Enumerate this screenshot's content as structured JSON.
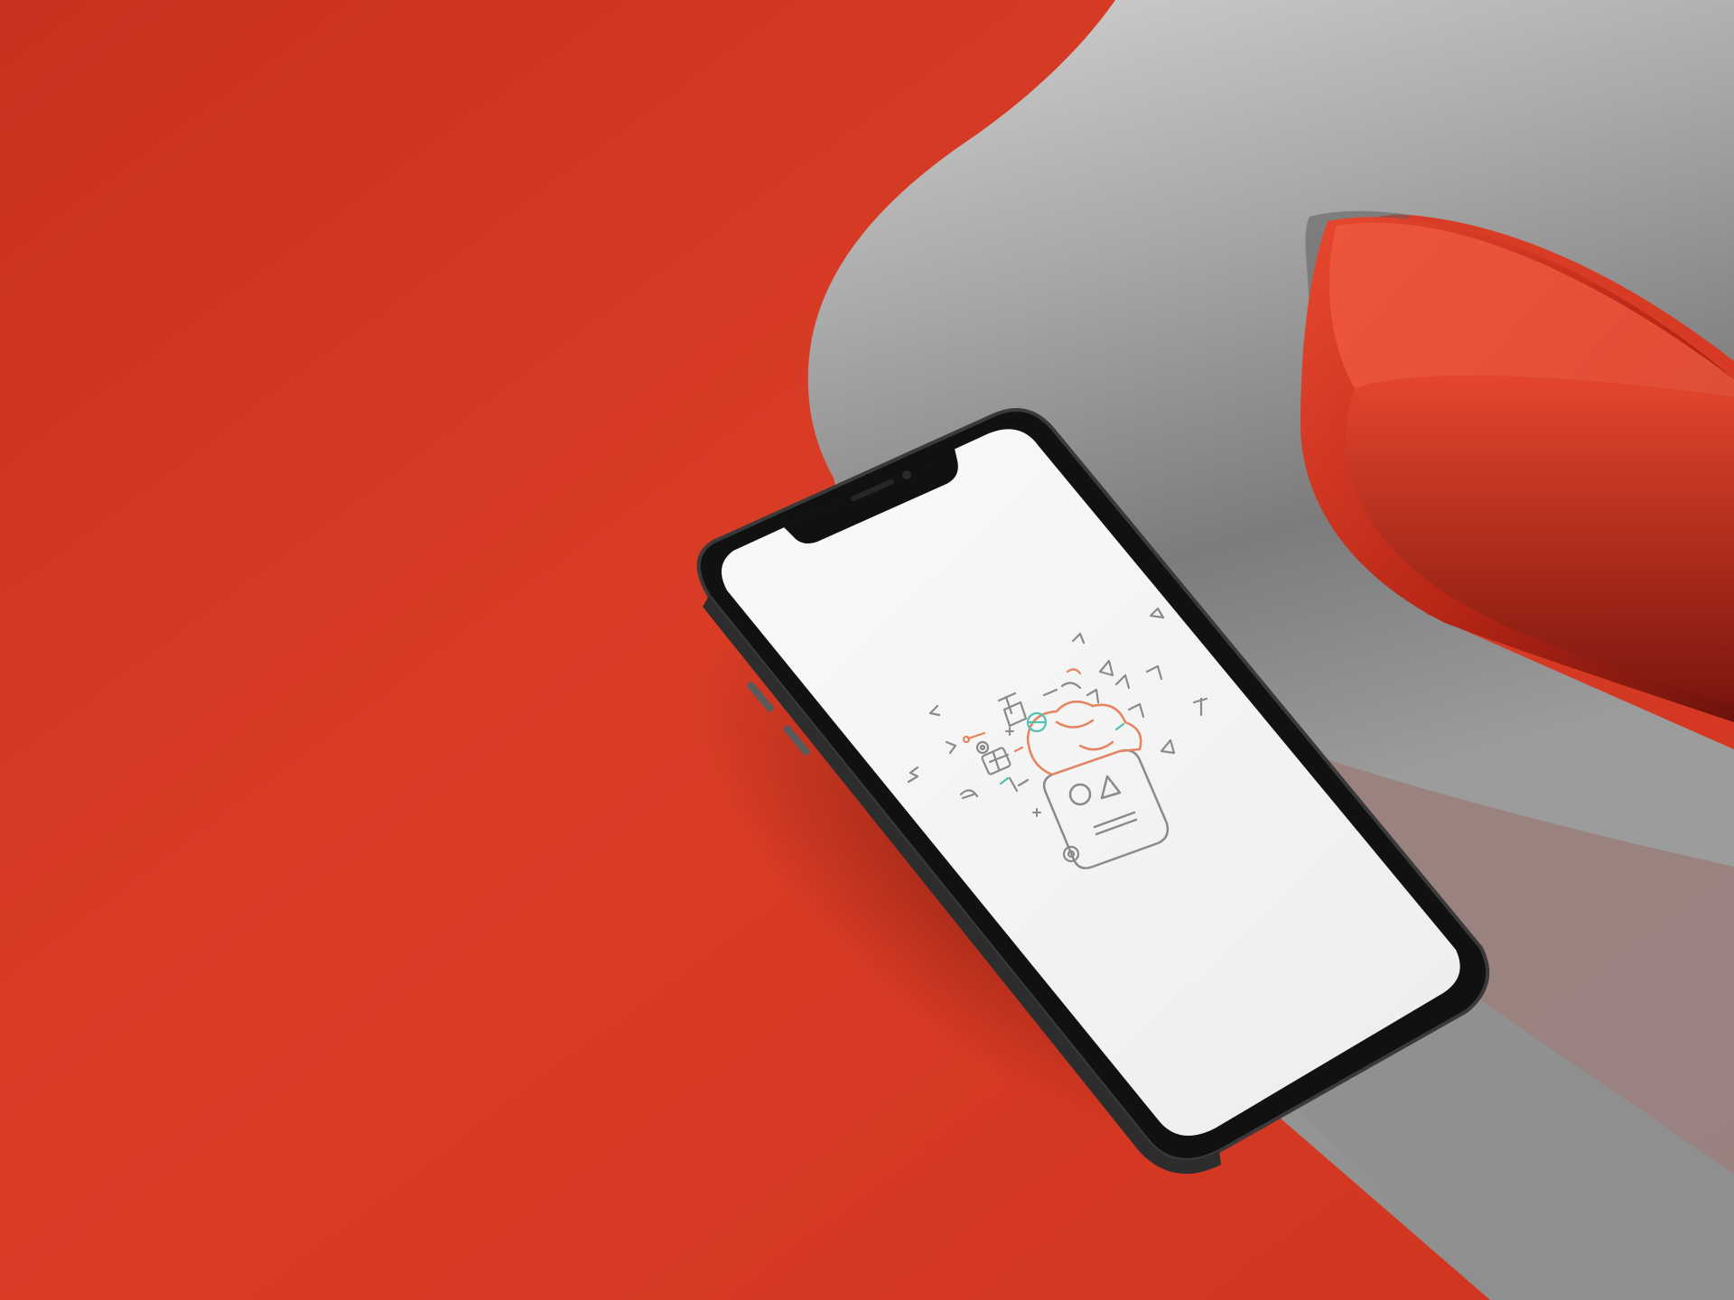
{
  "scene": {
    "background_color": "#d63a24",
    "background_shadow_color": "#9e2112",
    "ribbon_light_color": "#c9c9c9",
    "ribbon_mid_color": "#9a9a9a",
    "ribbon_dark_color": "#5b5b5b",
    "ribbon_red_color": "#e14530",
    "ribbon_red_dark_color": "#7a140d",
    "phone_frame_color": "#111111",
    "phone_rim_color": "#3a3a3a",
    "screen_color": "#f4f4f4"
  },
  "wallpaper": {
    "icon_names": [
      "robot-head-icon",
      "brain-icon",
      "gear-icon",
      "arrow-icon",
      "wrench-icon",
      "globe-icon",
      "hammer-icon",
      "rocket-icon",
      "star-icon"
    ],
    "line_color": "#8a8a8a",
    "accent_orange": "#e5845f",
    "accent_teal": "#4fc2b1"
  }
}
